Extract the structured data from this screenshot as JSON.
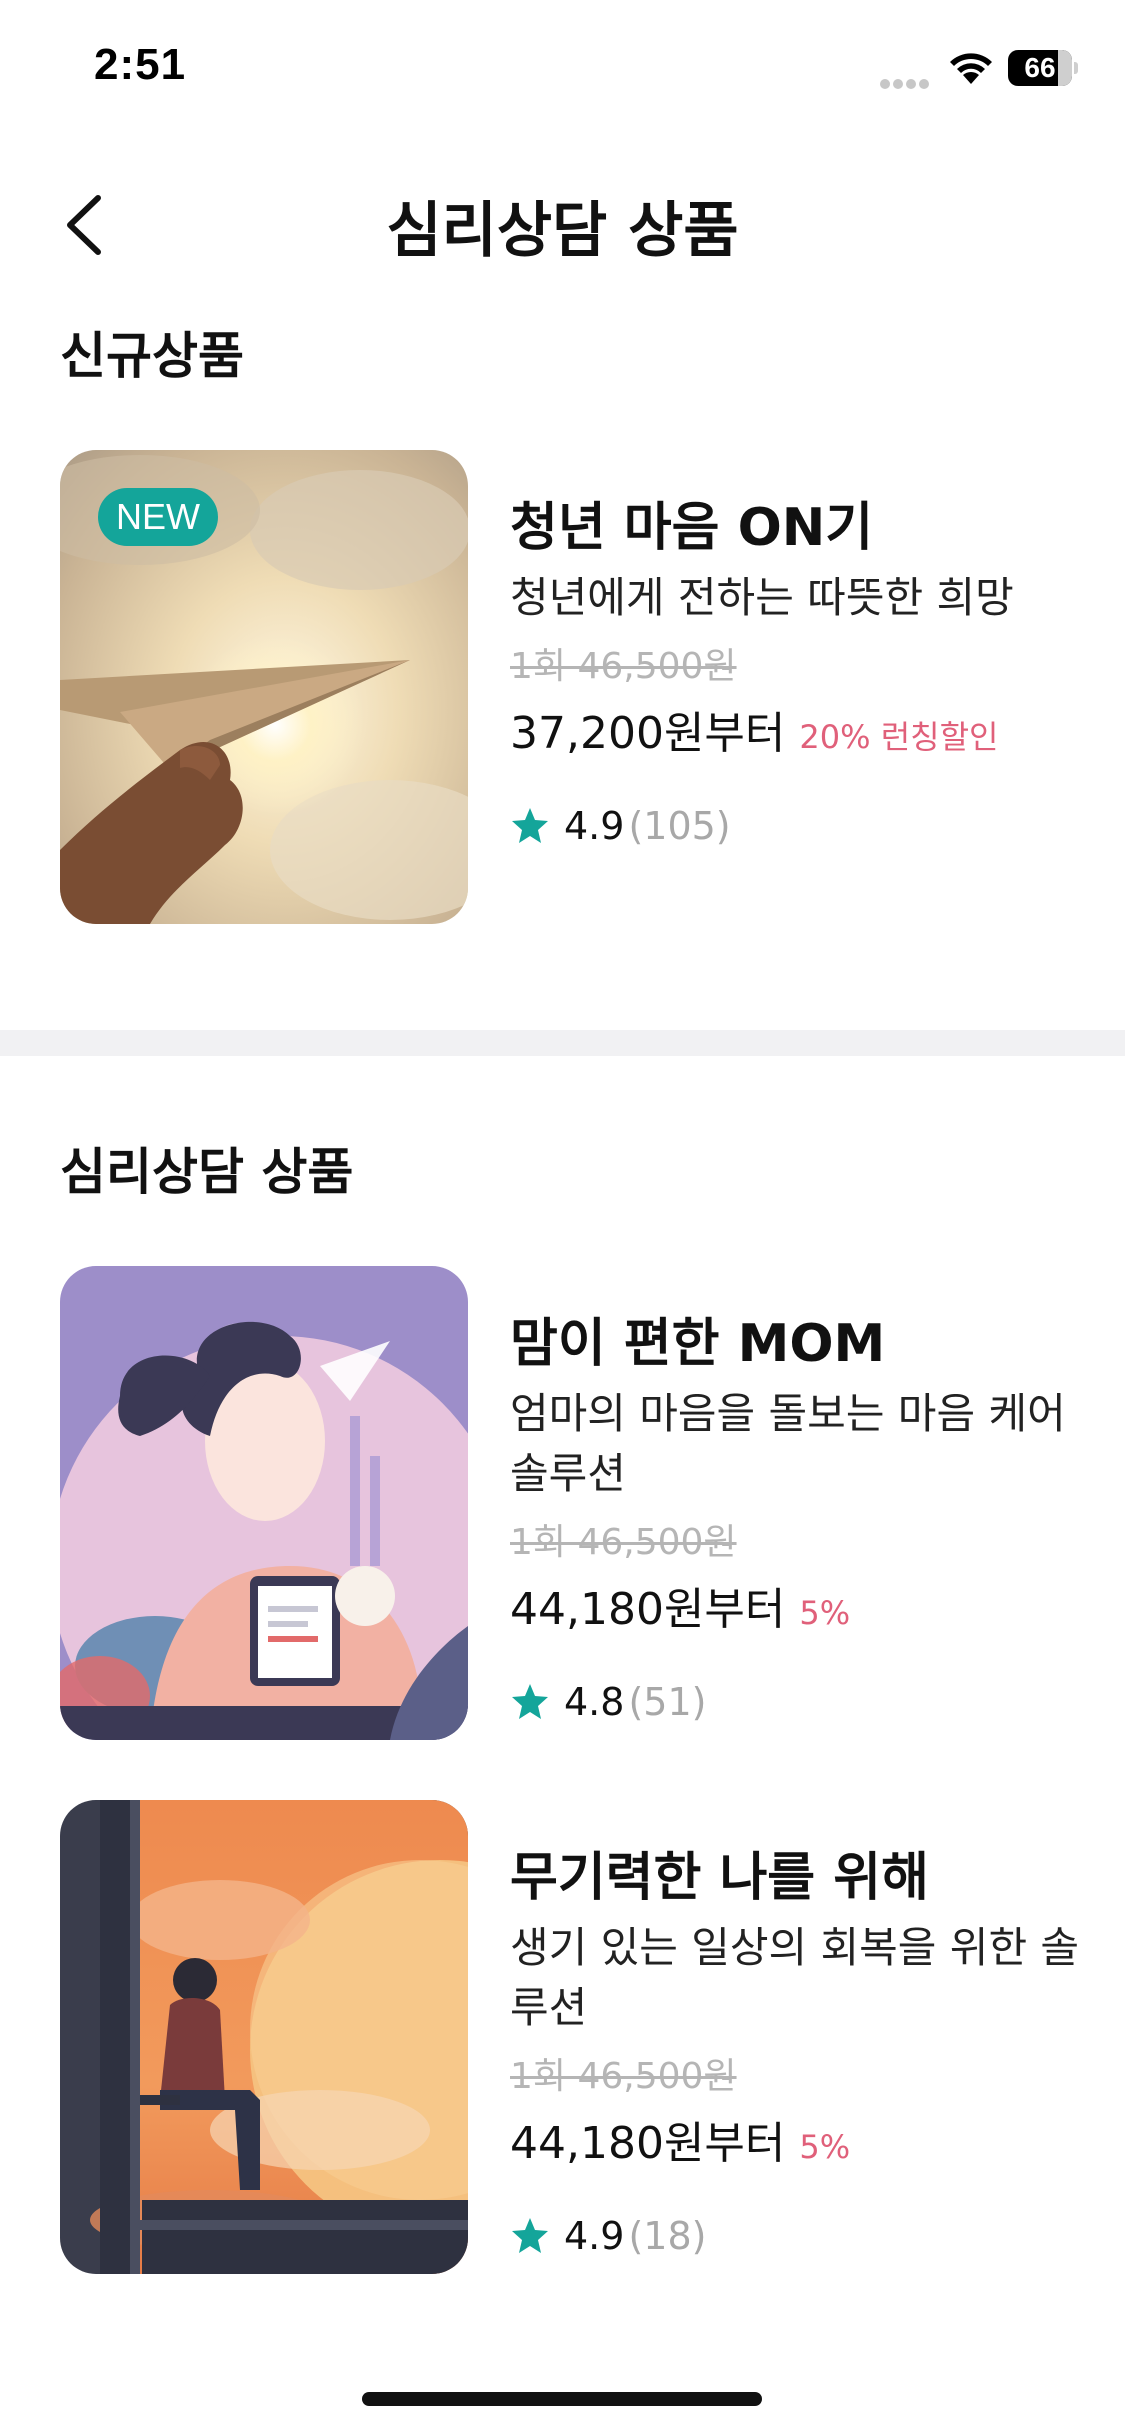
{
  "status_bar": {
    "time": "2:51",
    "battery": "66"
  },
  "header": {
    "title": "심리상담 상품"
  },
  "sections": [
    {
      "title": "신규상품",
      "products": [
        {
          "badge": "NEW",
          "title": "청년 마음 ON기",
          "description": "청년에게 전하는 따뜻한 희망",
          "original_price": "1회 46,500원",
          "price": "37,200원부터",
          "discount": "20% 런칭할인",
          "rating": "4.9",
          "review_count": "(105)"
        }
      ]
    },
    {
      "title": "심리상담 상품",
      "products": [
        {
          "title": "맘이 편한 MOM",
          "description": "엄마의 마음을 돌보는 마음 케어 솔루션",
          "original_price": "1회 46,500원",
          "price": "44,180원부터",
          "discount": "5%",
          "rating": "4.8",
          "review_count": "(51)"
        },
        {
          "title": "무기력한 나를 위해",
          "description": "생기 있는 일상의 회복을 위한 솔루션",
          "original_price": "1회 46,500원",
          "price": "44,180원부터",
          "discount": "5%",
          "rating": "4.9",
          "review_count": "(18)"
        }
      ]
    }
  ],
  "colors": {
    "accent": "#14a59a",
    "discount": "#e0607a",
    "muted": "#a8a8a8"
  }
}
